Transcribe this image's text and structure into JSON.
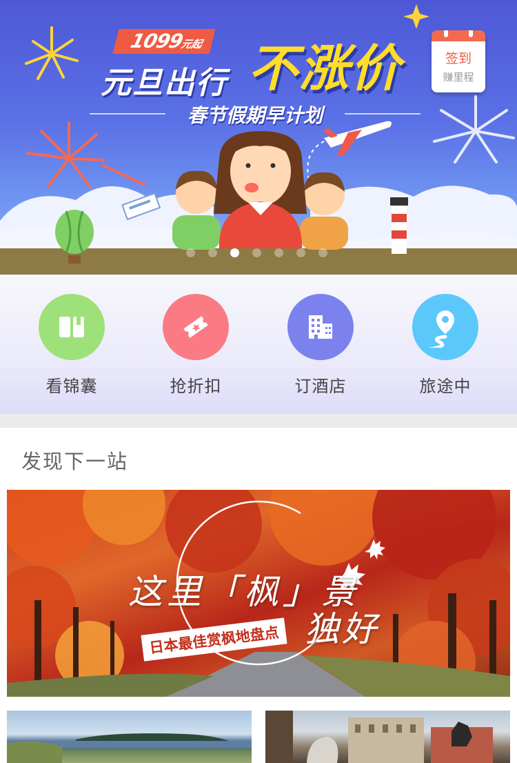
{
  "banner": {
    "price_badge": {
      "number": "1099",
      "suffix": "元起"
    },
    "line1": "元旦出行",
    "headline": "不涨价",
    "subtitle": "春节假期早计划",
    "carousel": {
      "count": 7,
      "active_index": 2
    }
  },
  "checkin": {
    "label": "签到",
    "sub_label": "赚里程"
  },
  "quick_nav": {
    "items": [
      {
        "label": "看锦囊",
        "icon": "book-icon",
        "color": "#9ee07a"
      },
      {
        "label": "抢折扣",
        "icon": "ticket-icon",
        "color": "#fb7b84"
      },
      {
        "label": "订酒店",
        "icon": "hotel-building-icon",
        "color": "#7b82ee"
      },
      {
        "label": "旅途中",
        "icon": "location-pin-icon",
        "color": "#5bc8fb"
      }
    ]
  },
  "discover": {
    "title": "发现下一站",
    "feature": {
      "title_line1": "这里「枫」景",
      "title_line2": "独好",
      "subtitle": "日本最佳赏枫地盘点"
    }
  }
}
